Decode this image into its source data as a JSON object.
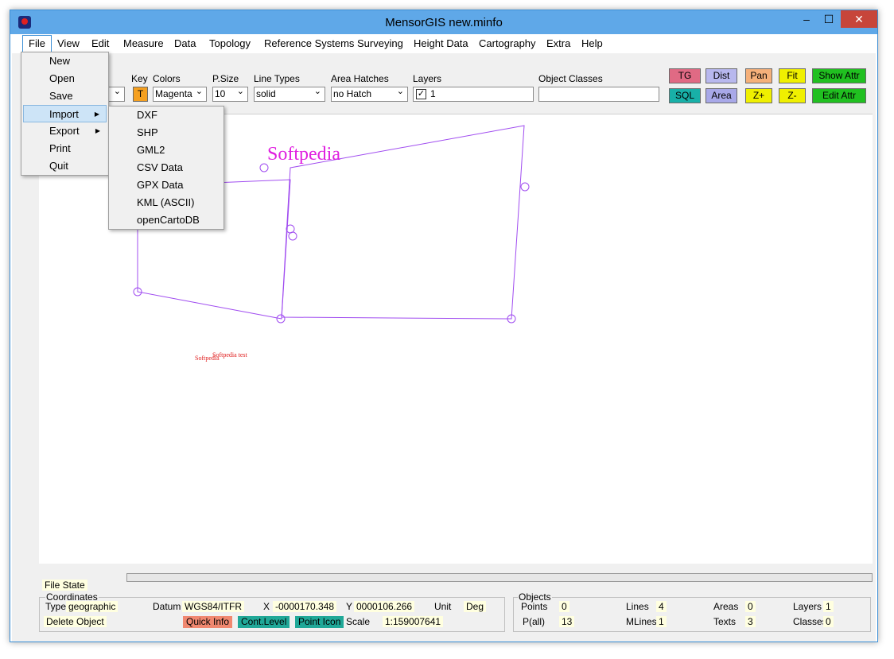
{
  "window": {
    "title": "MensorGIS new.minfo",
    "min": "–",
    "max": "☐",
    "close": "✕"
  },
  "menu": [
    "File",
    "View",
    "Edit",
    "Measure",
    "Data",
    "Topology",
    "Reference Systems",
    "Surveying",
    "Height Data",
    "Cartography",
    "Extra",
    "Help"
  ],
  "file_menu": [
    "New",
    "Open",
    "Save",
    "Import",
    "Export",
    "Print",
    "Quit"
  ],
  "import_menu": [
    "DXF",
    "SHP",
    "GML2",
    "CSV Data",
    "GPX Data",
    "KML (ASCII)",
    "openCartoDB"
  ],
  "toolbar": {
    "key_label": "Key",
    "key_value": "T",
    "colors_label": "Colors",
    "colors_value": "Magenta",
    "psize_label": "P.Size",
    "psize_value": "10",
    "linetypes_label": "Line Types",
    "linetypes_value": "solid",
    "hatch_label": "Area Hatches",
    "hatch_value": "no Hatch",
    "layers_label": "Layers",
    "layers_value": "1",
    "layers_check": "✓",
    "objclass_label": "Object Classes",
    "objclass_value": ""
  },
  "tool_buttons": [
    {
      "label": "TG",
      "color": "#e06a84"
    },
    {
      "label": "Dist",
      "color": "#b8b8ee"
    },
    {
      "label": "Pan",
      "color": "#f5b07a"
    },
    {
      "label": "Fit",
      "color": "#f0f000"
    },
    {
      "label": "Show Attr",
      "color": "#20c020"
    },
    {
      "label": "SQL",
      "color": "#18b0a8"
    },
    {
      "label": "Area",
      "color": "#a8a8e8"
    },
    {
      "label": "Z+",
      "color": "#f0f000"
    },
    {
      "label": "Z-",
      "color": "#f0f000"
    },
    {
      "label": "Edit Attr",
      "color": "#20c020"
    }
  ],
  "map": {
    "label_large": "Softpedia",
    "label_small_1": "Softpedia",
    "label_small_2": "Softpedia test",
    "line_color": "#a04cf0",
    "text_color_large": "#e020e0",
    "text_color_small": "#e02020"
  },
  "status": {
    "file_state": "File State",
    "coordinates": "Coordinates",
    "type_label": "Type",
    "type_value": "geographic",
    "datum_label": "Datum",
    "datum_value": "WGS84/ITFR",
    "x_label": "X",
    "x_value": "-0000170.348",
    "y_label": "Y",
    "y_value": "0000106.266",
    "unit_label": "Unit",
    "unit_value": "Deg",
    "delete_object": "Delete Object",
    "quick_info": "Quick Info",
    "cont_level": "Cont.Level",
    "point_icon": "Point Icon",
    "scale_label": "Scale",
    "scale_value": "1:159007641",
    "objects": "Objects",
    "points_label": "Points",
    "points_value": "0",
    "pall_label": "P(all)",
    "pall_value": "13",
    "lines_label": "Lines",
    "lines_value": "4",
    "mlines_label": "MLines",
    "mlines_value": "1",
    "areas_label": "Areas",
    "areas_value": "0",
    "texts_label": "Texts",
    "texts_value": "3",
    "layers_label": "Layers",
    "layers_value": "1",
    "classes_label": "Classes",
    "classes_value": "0"
  }
}
